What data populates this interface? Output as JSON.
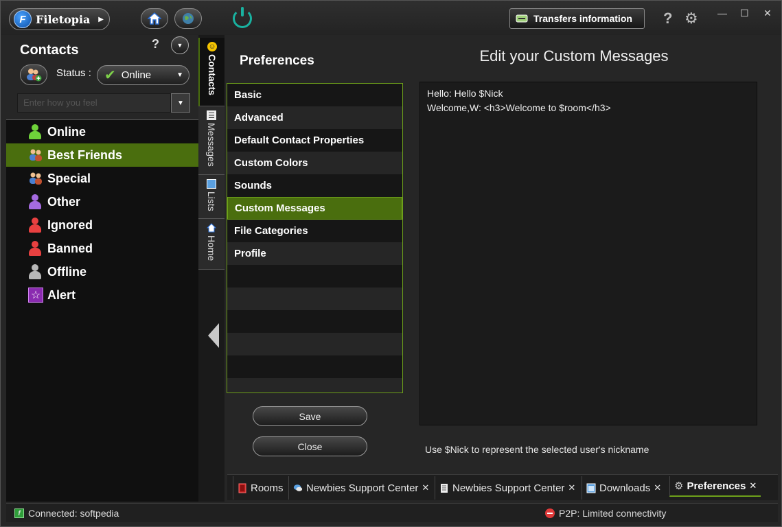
{
  "titlebar": {
    "app_name": "Filetopia",
    "logo_letter": "F",
    "transfers_label": "Transfers information",
    "help_glyph": "?",
    "settings_glyph": "⚙",
    "minimize_glyph": "—",
    "maximize_glyph": "☐",
    "close_glyph": "✕"
  },
  "contacts_panel": {
    "title": "Contacts",
    "help_glyph": "?",
    "status_label": "Status :",
    "status_value": "Online",
    "feel_placeholder": "Enter how you feel",
    "items": [
      {
        "label": "Online",
        "icon": "green-person-icon",
        "color": "#6fd23a"
      },
      {
        "label": "Best Friends",
        "icon": "group-icon",
        "color": "#e0b060"
      },
      {
        "label": "Special",
        "icon": "group-icon",
        "color": "#e0b060"
      },
      {
        "label": "Other",
        "icon": "purple-person-icon",
        "color": "#a46ae0"
      },
      {
        "label": "Ignored",
        "icon": "red-person-icon",
        "color": "#e84040"
      },
      {
        "label": "Banned",
        "icon": "red-person-icon",
        "color": "#e84040"
      },
      {
        "label": "Offline",
        "icon": "gray-person-icon",
        "color": "#b8b8b8"
      },
      {
        "label": "Alert",
        "icon": "star-icon",
        "color": "#8a2bb0"
      }
    ],
    "selected_index": 1
  },
  "vertical_tabs": [
    {
      "label": "Contacts",
      "icon": "smiley-icon"
    },
    {
      "label": "Messages",
      "icon": "messages-icon"
    },
    {
      "label": "Lists",
      "icon": "lists-icon"
    },
    {
      "label": "Home",
      "icon": "home-icon"
    }
  ],
  "preferences": {
    "title": "Preferences",
    "items": [
      "Basic",
      "Advanced",
      "Default Contact Properties",
      "Custom Colors",
      "Sounds",
      "Custom Messages",
      "File Categories",
      "Profile"
    ],
    "selected": "Custom Messages",
    "save_label": "Save",
    "close_label": "Close"
  },
  "editor": {
    "title": "Edit your Custom Messages",
    "lines": [
      "Hello: Hello $Nick",
      "Welcome,W: <h3>Welcome to $room</h3>"
    ],
    "hint": "Use $Nick to represent the selected user's nickname"
  },
  "bottom_tabs": [
    {
      "label": "Rooms",
      "icon": "rooms-icon",
      "closable": false
    },
    {
      "label": "Newbies Support Center",
      "icon": "chat-icon",
      "closable": true
    },
    {
      "label": "Newbies Support Center",
      "icon": "document-icon",
      "closable": true
    },
    {
      "label": "Downloads",
      "icon": "downloads-icon",
      "closable": true
    },
    {
      "label": "Preferences",
      "icon": "gear-icon",
      "closable": true,
      "active": true
    }
  ],
  "statusbar": {
    "connection": "Connected: softpedia",
    "p2p": "P2P: Limited connectivity"
  },
  "colors": {
    "accent_green": "#4a6e0e",
    "border_green": "#6da01a",
    "teal": "#19b2a0"
  }
}
